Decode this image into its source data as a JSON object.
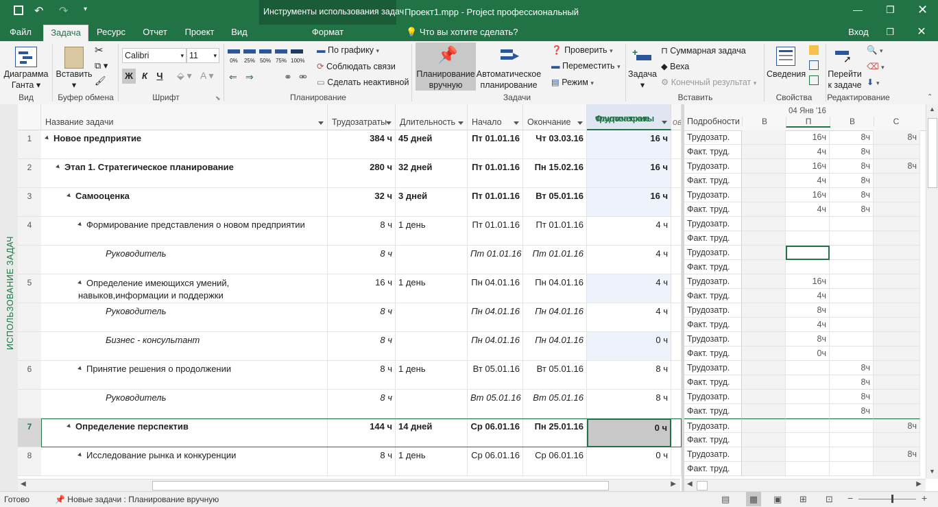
{
  "window": {
    "contextual_group": "Инструменты использования задач",
    "title": "Проект1.mpp - Project профессиональный",
    "signin": "Вход"
  },
  "tabs": [
    "Файл",
    "Задача",
    "Ресурс",
    "Отчет",
    "Проект",
    "Вид"
  ],
  "contextual_tab": "Формат",
  "tell_me": "Что вы хотите сделать?",
  "ribbon": {
    "view_group": {
      "gantt": "Диаграмма",
      "gantt2": "Ганта",
      "label": "Вид"
    },
    "clipboard": {
      "paste": "Вставить",
      "label": "Буфер обмена"
    },
    "font": {
      "name": "Calibri",
      "size": "11",
      "bold": "Ж",
      "italic": "К",
      "underline": "Ч",
      "label": "Шрифт"
    },
    "schedule": {
      "pct": [
        "0%",
        "25%",
        "50%",
        "75%",
        "100%"
      ],
      "on_schedule": "По графику",
      "respect_links": "Соблюдать связи",
      "inactivate": "Сделать неактивной",
      "label": "Планирование"
    },
    "tasks": {
      "manual": "Планирование",
      "manual2": "вручную",
      "auto": "Автоматическое",
      "auto2": "планирование",
      "inspect": "Проверить",
      "move": "Переместить",
      "mode": "Режим",
      "label": "Задачи"
    },
    "insert": {
      "task": "Задача",
      "summary": "Суммарная задача",
      "milestone": "Веха",
      "deliverable": "Конечный результат",
      "label": "Вставить"
    },
    "properties": {
      "info": "Сведения",
      "label": "Свойства"
    },
    "editing": {
      "goto": "Перейти",
      "goto2": "к задаче",
      "label": "Редактирование"
    }
  },
  "sidebar_label": "ИСПОЛЬЗОВАНИЕ ЗАДАЧ",
  "columns": {
    "name": "Название задачи",
    "work": "Трудозатраты",
    "duration": "Длительность",
    "start": "Начало",
    "finish": "Окончание",
    "actual1": "Фактические",
    "actual2": "трудозатраты",
    "extra": "ов"
  },
  "rows": [
    {
      "id": "1",
      "name": "Новое предприятие",
      "name2": "",
      "work": "384 ч",
      "duration": "45 дней",
      "start": "Пт 01.01.16",
      "finish": "Чт 03.03.16",
      "actual": "16 ч"
    },
    {
      "id": "2",
      "name": "Этап 1. Стратегическое планирование",
      "name2": "",
      "work": "280 ч",
      "duration": "32 дней",
      "start": "Пт 01.01.16",
      "finish": "Пн 15.02.16",
      "actual": "16 ч"
    },
    {
      "id": "3",
      "name": "Самооценка",
      "name2": "",
      "work": "32 ч",
      "duration": "3 дней",
      "start": "Пт 01.01.16",
      "finish": "Вт 05.01.16",
      "actual": "16 ч"
    },
    {
      "id": "4",
      "name": "Формирование представления о новом предприятии",
      "name2": "",
      "work": "8 ч",
      "duration": "1 день",
      "start": "Пт 01.01.16",
      "finish": "Пт 01.01.16",
      "actual": "4 ч"
    },
    {
      "id": "",
      "name": "Руководитель",
      "name2": "",
      "work": "8 ч",
      "duration": "",
      "start": "Пт 01.01.16",
      "finish": "Пт 01.01.16",
      "actual": "4 ч"
    },
    {
      "id": "5",
      "name": "Определение имеющихся умений,",
      "name2": "навыков,информации и поддержки",
      "work": "16 ч",
      "duration": "1 день",
      "start": "Пн 04.01.16",
      "finish": "Пн 04.01.16",
      "actual": "4 ч"
    },
    {
      "id": "",
      "name": "Руководитель",
      "name2": "",
      "work": "8 ч",
      "duration": "",
      "start": "Пн 04.01.16",
      "finish": "Пн 04.01.16",
      "actual": "4 ч"
    },
    {
      "id": "",
      "name": "Бизнес - консультант",
      "name2": "",
      "work": "8 ч",
      "duration": "",
      "start": "Пн 04.01.16",
      "finish": "Пн 04.01.16",
      "actual": "0 ч"
    },
    {
      "id": "6",
      "name": "Принятие решения о продолжении",
      "name2": "",
      "work": "8 ч",
      "duration": "1 день",
      "start": "Вт 05.01.16",
      "finish": "Вт 05.01.16",
      "actual": "8 ч"
    },
    {
      "id": "",
      "name": "Руководитель",
      "name2": "",
      "work": "8 ч",
      "duration": "",
      "start": "Вт 05.01.16",
      "finish": "Вт 05.01.16",
      "actual": "8 ч"
    },
    {
      "id": "7",
      "name": "Определение перспектив",
      "name2": "",
      "work": "144 ч",
      "duration": "14 дней",
      "start": "Ср 06.01.16",
      "finish": "Пн 25.01.16",
      "actual": "0 ч"
    },
    {
      "id": "8",
      "name": "Исследование рынка и конкуренции",
      "name2": "",
      "work": "8 ч",
      "duration": "1 день",
      "start": "Ср 06.01.16",
      "finish": "Ср 06.01.16",
      "actual": "0 ч"
    }
  ],
  "timephased": {
    "details_header": "Подробности",
    "week": "04 Янв '16",
    "days": [
      "В",
      "П",
      "В",
      "С"
    ],
    "label_work": "Трудозатр.",
    "label_actual": "Факт. труд.",
    "values": [
      [
        "",
        "16ч",
        "8ч",
        "8ч"
      ],
      [
        "",
        "4ч",
        "8ч",
        ""
      ],
      [
        "",
        "16ч",
        "8ч",
        "8ч"
      ],
      [
        "",
        "4ч",
        "8ч",
        ""
      ],
      [
        "",
        "16ч",
        "8ч",
        ""
      ],
      [
        "",
        "4ч",
        "8ч",
        ""
      ],
      [
        "",
        "",
        "",
        ""
      ],
      [
        "",
        "",
        "",
        ""
      ],
      [
        "",
        "",
        "",
        ""
      ],
      [
        "",
        "",
        "",
        ""
      ],
      [
        "",
        "16ч",
        "",
        ""
      ],
      [
        "",
        "4ч",
        "",
        ""
      ],
      [
        "",
        "8ч",
        "",
        ""
      ],
      [
        "",
        "4ч",
        "",
        ""
      ],
      [
        "",
        "8ч",
        "",
        ""
      ],
      [
        "",
        "0ч",
        "",
        ""
      ],
      [
        "",
        "",
        "8ч",
        ""
      ],
      [
        "",
        "",
        "8ч",
        ""
      ],
      [
        "",
        "",
        "8ч",
        ""
      ],
      [
        "",
        "",
        "8ч",
        ""
      ],
      [
        "",
        "",
        "",
        "8ч"
      ],
      [
        "",
        "",
        "",
        ""
      ],
      [
        "",
        "",
        "",
        "8ч"
      ],
      [
        "",
        "",
        "",
        ""
      ]
    ]
  },
  "status": {
    "ready": "Готово",
    "new_tasks": "Новые задачи : Планирование вручную"
  }
}
